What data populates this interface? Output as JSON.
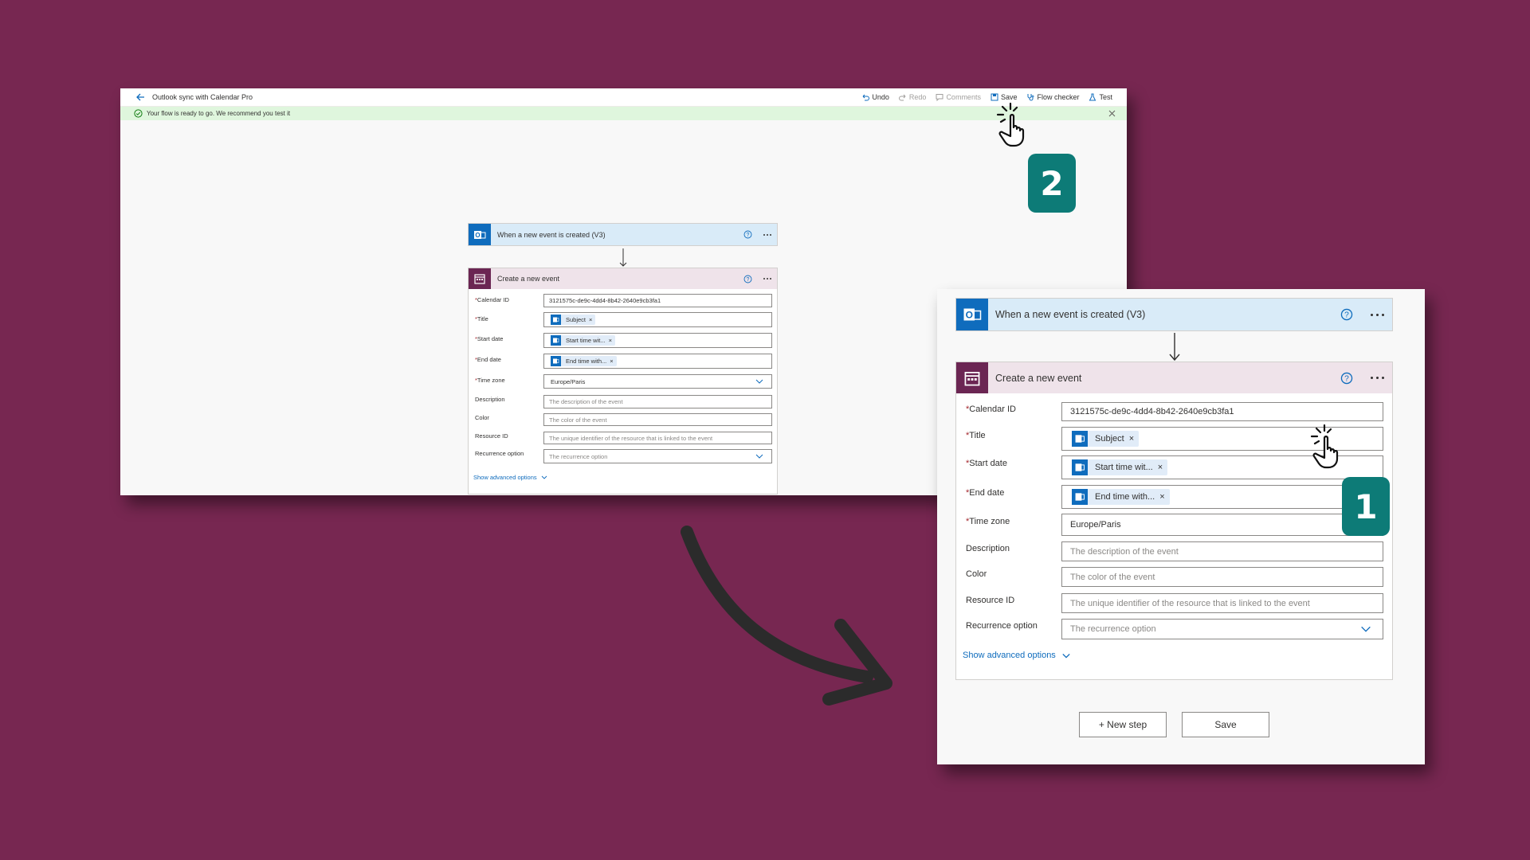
{
  "app": {
    "flow_title": "Outlook sync with Calendar Pro",
    "toolbar": {
      "undo": "Undo",
      "redo": "Redo",
      "comments": "Comments",
      "save": "Save",
      "flow_checker": "Flow checker",
      "test": "Test"
    },
    "banner": "Your flow is ready to go. We recommend you test it"
  },
  "trigger": {
    "title": "When a new event is created (V3)"
  },
  "action": {
    "title": "Create a new event",
    "fields": {
      "calendar_id": {
        "label": "Calendar ID",
        "required": "*",
        "value": "3121575c-de9c-4dd4-8b42-2640e9cb3fa1"
      },
      "title": {
        "label": "Title",
        "required": "*",
        "token": "Subject"
      },
      "start_date": {
        "label": "Start date",
        "required": "*",
        "token": "Start time wit..."
      },
      "end_date": {
        "label": "End date",
        "required": "*",
        "token": "End time with..."
      },
      "time_zone": {
        "label": "Time zone",
        "required": "*",
        "value": "Europe/Paris"
      },
      "description": {
        "label": "Description",
        "placeholder": "The description of the event"
      },
      "color": {
        "label": "Color",
        "placeholder": "The color of the event"
      },
      "resource_id": {
        "label": "Resource ID",
        "placeholder": "The unique identifier of the resource that is linked to the event"
      },
      "recurrence": {
        "label": "Recurrence option",
        "placeholder": "The recurrence option"
      }
    },
    "show_advanced": "Show advanced options"
  },
  "buttons": {
    "new_step": "+ New step",
    "save": "Save"
  },
  "badges": {
    "step1": "1",
    "step2": "2"
  },
  "token_remove": "×",
  "colors": {
    "background": "#772751",
    "accent_blue": "#0f6cbd",
    "badge_teal": "#0d7b77",
    "calendar_purple": "#6b2653"
  }
}
